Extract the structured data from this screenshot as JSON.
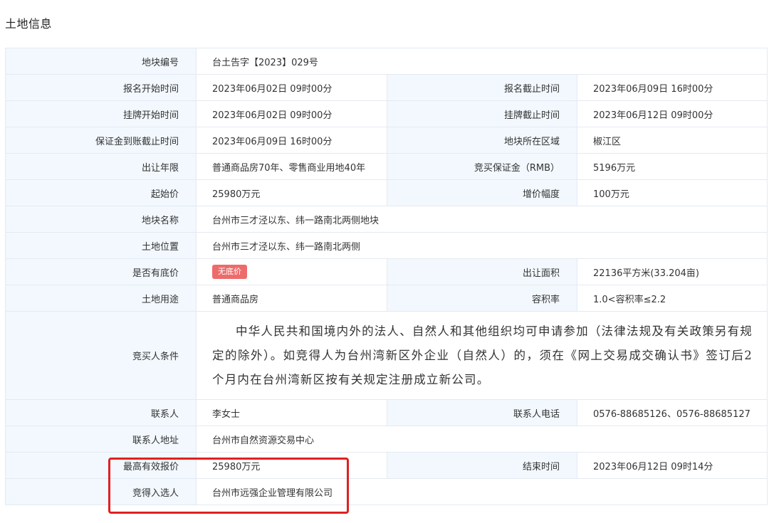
{
  "title": "土地信息",
  "rows": {
    "plot_number": {
      "label": "地块编号",
      "value": "台土告字【2023】029号"
    },
    "reg_start": {
      "label": "报名开始时间",
      "value": "2023年06月02日 09时00分"
    },
    "reg_end": {
      "label": "报名截止时间",
      "value": "2023年06月09日 16时00分"
    },
    "list_start": {
      "label": "挂牌开始时间",
      "value": "2023年06月02日 09时00分"
    },
    "list_end": {
      "label": "挂牌截止时间",
      "value": "2023年06月12日 09时00分"
    },
    "deposit_deadline": {
      "label": "保证金到账截止时间",
      "value": "2023年06月09日 16时00分"
    },
    "region": {
      "label": "地块所在区域",
      "value": "椒江区"
    },
    "term": {
      "label": "出让年限",
      "value": "普通商品房70年、零售商业用地40年"
    },
    "deposit": {
      "label": "竞买保证金（RMB）",
      "value": "5196万元"
    },
    "start_price": {
      "label": "起始价",
      "value": "25980万元"
    },
    "increment": {
      "label": "增价幅度",
      "value": "100万元"
    },
    "plot_name": {
      "label": "地块名称",
      "value": "台州市三才泾以东、纬一路南北两侧地块"
    },
    "location": {
      "label": "土地位置",
      "value": "台州市三才泾以东、纬一路南北两侧"
    },
    "reserve_price": {
      "label": "是否有底价",
      "tag": "无底价"
    },
    "area": {
      "label": "出让面积",
      "value": "22136平方米(33.204亩)"
    },
    "usage": {
      "label": "土地用途",
      "value": "普通商品房"
    },
    "far": {
      "label": "容积率",
      "value": "1.0<容积率≤2.2"
    },
    "bidder_conditions": {
      "label": "竞买人条件",
      "value": "中华人民共和国境内外的法人、自然人和其他组织均可申请参加（法律法规及有关政策另有规定的除外）。如竞得人为台州湾新区外企业（自然人）的，须在《网上交易成交确认书》签订后2个月内在台州湾新区按有关规定注册成立新公司。"
    },
    "contact": {
      "label": "联系人",
      "value": "李女士"
    },
    "contact_phone": {
      "label": "联系人电话",
      "value": "0576-88685126、0576-88685127"
    },
    "contact_address": {
      "label": "联系人地址",
      "value": "台州市自然资源交易中心"
    },
    "highest_bid": {
      "label": "最高有效报价",
      "value": "25980万元"
    },
    "end_time": {
      "label": "结束时间",
      "value": "2023年06月12日 09时14分"
    },
    "winner": {
      "label": "竞得入选人",
      "value": "台州市远强企业管理有限公司"
    }
  },
  "colors": {
    "label_bg": "#f2f8fd",
    "border": "#e4eaf2",
    "tag_bg": "#ee6b6b",
    "highlight": "#e02020"
  }
}
